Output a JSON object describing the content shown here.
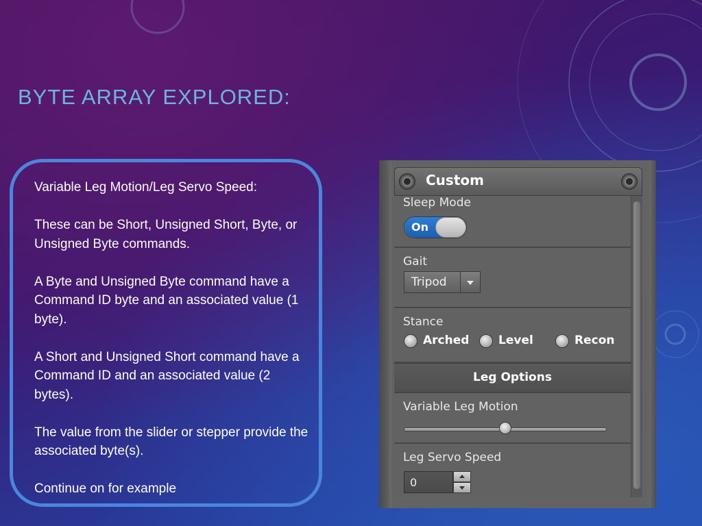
{
  "slide": {
    "title": "BYTE ARRAY EXPLORED:"
  },
  "text_box": {
    "paragraphs": [
      "Variable Leg Motion/Leg Servo Speed:",
      "These can be Short, Unsigned Short, Byte, or Unsigned Byte commands.",
      "A Byte and Unsigned Byte command have a Command ID byte and an associated value (1 byte).",
      "A Short and Unsigned Short command have a Command ID and an associated value (2 bytes).",
      "The value from the slider or stepper provide the associated byte(s).",
      "Continue on for example"
    ]
  },
  "panel": {
    "title": "Custom",
    "sleep_mode": {
      "label": "Sleep Mode",
      "toggle_text": "On",
      "state": "on"
    },
    "gait": {
      "label": "Gait",
      "selected": "Tripod"
    },
    "stance": {
      "label": "Stance",
      "options": [
        "Arched",
        "Level",
        "Recon"
      ]
    },
    "leg_options": {
      "header": "Leg Options"
    },
    "variable_leg_motion": {
      "label": "Variable Leg Motion",
      "slider_position": 0.5
    },
    "leg_servo_speed": {
      "label": "Leg Servo Speed",
      "value": "0"
    }
  },
  "colors": {
    "title": "#6db5e0",
    "text_box_border": "#4a86dc",
    "toggle_on": "#1a5eb0",
    "panel_bg": "#636363"
  }
}
